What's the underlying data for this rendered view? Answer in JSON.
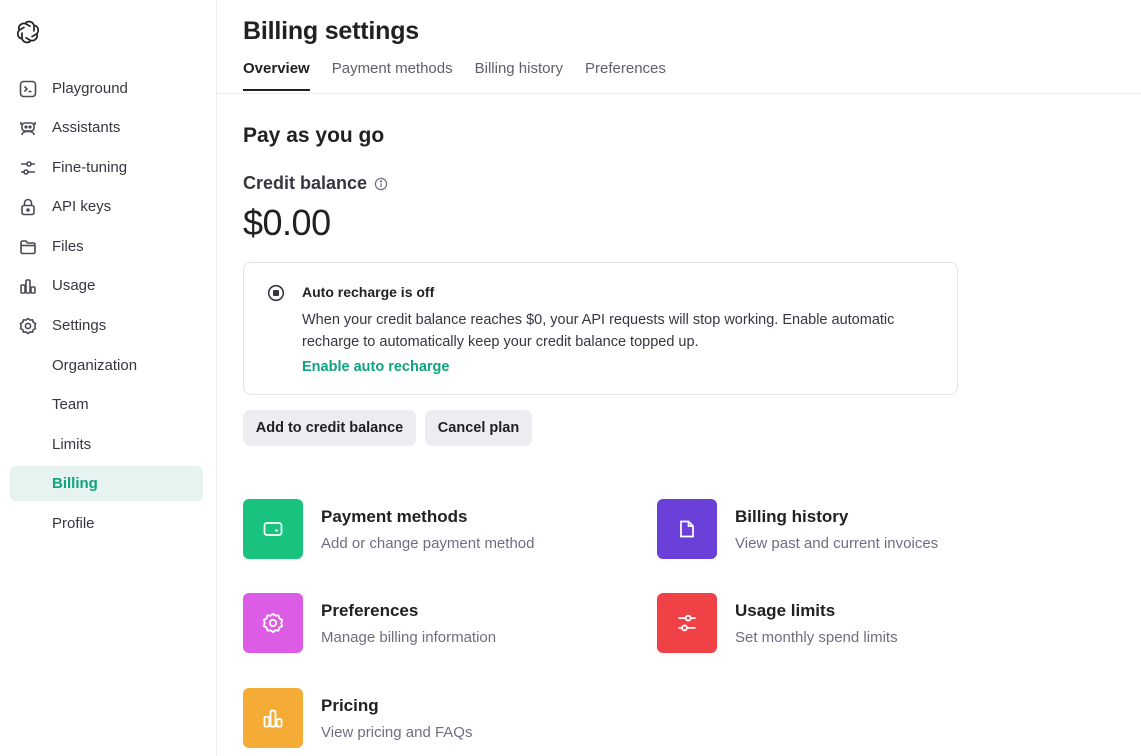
{
  "sidebar": {
    "logo": "openai-logo",
    "items": [
      {
        "label": "Playground",
        "icon": "terminal-icon"
      },
      {
        "label": "Assistants",
        "icon": "robot-icon"
      },
      {
        "label": "Fine-tuning",
        "icon": "sliders-icon"
      },
      {
        "label": "API keys",
        "icon": "lock-icon"
      },
      {
        "label": "Files",
        "icon": "folder-icon"
      },
      {
        "label": "Usage",
        "icon": "bar-chart-icon"
      },
      {
        "label": "Settings",
        "icon": "gear-icon"
      }
    ],
    "sub_items": [
      {
        "label": "Organization"
      },
      {
        "label": "Team"
      },
      {
        "label": "Limits"
      },
      {
        "label": "Billing",
        "active": true
      },
      {
        "label": "Profile"
      }
    ]
  },
  "header": {
    "title": "Billing settings",
    "tabs": [
      {
        "label": "Overview",
        "active": true
      },
      {
        "label": "Payment methods"
      },
      {
        "label": "Billing history"
      },
      {
        "label": "Preferences"
      }
    ]
  },
  "main": {
    "section_title": "Pay as you go",
    "credit_label": "Credit balance",
    "balance": "$0.00",
    "notice": {
      "title": "Auto recharge is off",
      "body": "When your credit balance reaches $0, your API requests will stop working. Enable automatic recharge to automatically keep your credit balance topped up.",
      "link": "Enable auto recharge"
    },
    "buttons": {
      "add": "Add to credit balance",
      "cancel": "Cancel plan"
    },
    "cards": [
      {
        "title": "Payment methods",
        "subtitle": "Add or change payment method",
        "icon": "card-icon",
        "color": "#19c37d"
      },
      {
        "title": "Billing history",
        "subtitle": "View past and current invoices",
        "icon": "document-icon",
        "color": "#6b40d8"
      },
      {
        "title": "Preferences",
        "subtitle": "Manage billing information",
        "icon": "gear-icon",
        "color": "#dd5ce5"
      },
      {
        "title": "Usage limits",
        "subtitle": "Set monthly spend limits",
        "icon": "sliders-icon",
        "color": "#ef4146"
      },
      {
        "title": "Pricing",
        "subtitle": "View pricing and FAQs",
        "icon": "bar-chart-icon",
        "color": "#f4ac36"
      }
    ]
  },
  "colors": {
    "accent": "#10a37f",
    "active_bg": "#e6f3f0"
  }
}
